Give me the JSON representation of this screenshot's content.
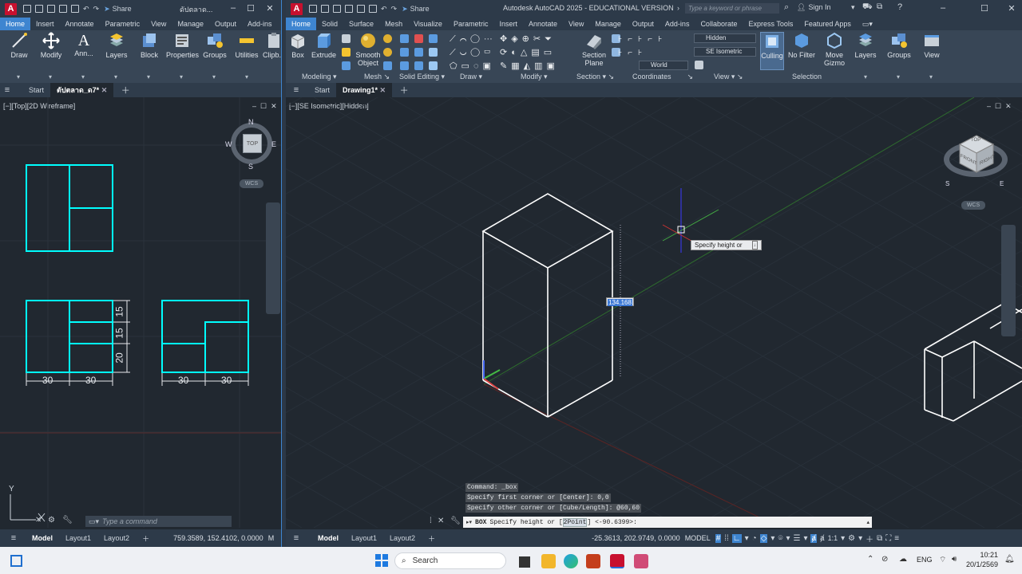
{
  "left_window": {
    "app_letter": "A",
    "title": "ดัปตลาด...",
    "share": "Share",
    "ribbon_tabs": [
      "Home",
      "Insert",
      "Annotate",
      "Parametric",
      "View",
      "Manage",
      "Output",
      "Add-ins"
    ],
    "active_tab": "Home",
    "tools": [
      "Draw",
      "Modify",
      "Ann...",
      "Layers",
      "Block",
      "Properties",
      "Groups",
      "Utilities",
      "Clipb..."
    ],
    "file_tabs": {
      "start": "Start",
      "active": "ตัปตลาด_ด7*"
    },
    "viewport_label": "[−][Top][2D Wireframe]",
    "compass": {
      "n": "N",
      "s": "S",
      "e": "E",
      "w": "W",
      "top": "TOP",
      "wcs": "WCS"
    },
    "dims": {
      "h1": "30",
      "h2": "30",
      "h3": "30",
      "h4": "30",
      "v1": "15",
      "v2": "15",
      "v3": "20"
    },
    "ucs": {
      "y": "Y",
      "x": "X"
    },
    "command_placeholder": "Type a command",
    "coords": "759.3589, 152.4102, 0.0000",
    "status_m": "M",
    "layout_tabs": [
      "Model",
      "Layout1",
      "Layout2"
    ]
  },
  "right_window": {
    "app_letter": "A",
    "title": "Autodesk AutoCAD 2025 - EDUCATIONAL VERSION",
    "search_placeholder": "Type a keyword or phrase",
    "sign_in": "Sign In",
    "share": "Share",
    "ribbon_tabs": [
      "Home",
      "Solid",
      "Surface",
      "Mesh",
      "Visualize",
      "Parametric",
      "Insert",
      "Annotate",
      "View",
      "Manage",
      "Output",
      "Add-ins",
      "Collaborate",
      "Express Tools",
      "Featured Apps"
    ],
    "active_tab": "Home",
    "tools": {
      "box": "Box",
      "extrude": "Extrude",
      "smooth": "Smooth\nObject",
      "section_plane": "Section\nPlane",
      "visual_style": "Hidden",
      "view_name": "SE Isometric",
      "ucs": "World",
      "culling": "Culling",
      "no_filter": "No Filter",
      "move_gizmo": "Move\nGizmo",
      "layers": "Layers",
      "groups": "Groups",
      "view": "View"
    },
    "panels": [
      "Modeling",
      "Mesh",
      "Solid Editing",
      "Draw",
      "Modify",
      "Section",
      "Coordinates",
      "View",
      "Selection"
    ],
    "file_tabs": {
      "start": "Start",
      "active": "Drawing1*"
    },
    "viewport_label": "[−][SE Isometric][Hidden]",
    "viewcube": {
      "top": "TOP",
      "front": "FRONT",
      "right": "RIGHT",
      "s": "S",
      "e": "E",
      "wcs": "WCS"
    },
    "tooltip": "Specify height or",
    "dyn_value": "134.168",
    "history": [
      "Command: _box",
      "Specify first corner or [Center]: 0,0",
      "Specify other corner or [Cube/Length]: @60,60"
    ],
    "command": {
      "prefix": "BOX",
      "text": "Specify height or [",
      "option": "2Point",
      "suffix": "] <-90.6399>:"
    },
    "coords": "-25.3613, 202.9749, 0.0000",
    "model_label": "MODEL",
    "layout_tabs": [
      "Model",
      "Layout1",
      "Layout2"
    ],
    "scale": "1:1"
  },
  "taskbar": {
    "search": "Search",
    "lang": "ENG",
    "time": "10:21",
    "date": "20/1/2569"
  },
  "colors": {
    "accent": "#3e85d0",
    "cyan": "#00ffff",
    "bg": "#212830",
    "ribbon": "#384656"
  }
}
